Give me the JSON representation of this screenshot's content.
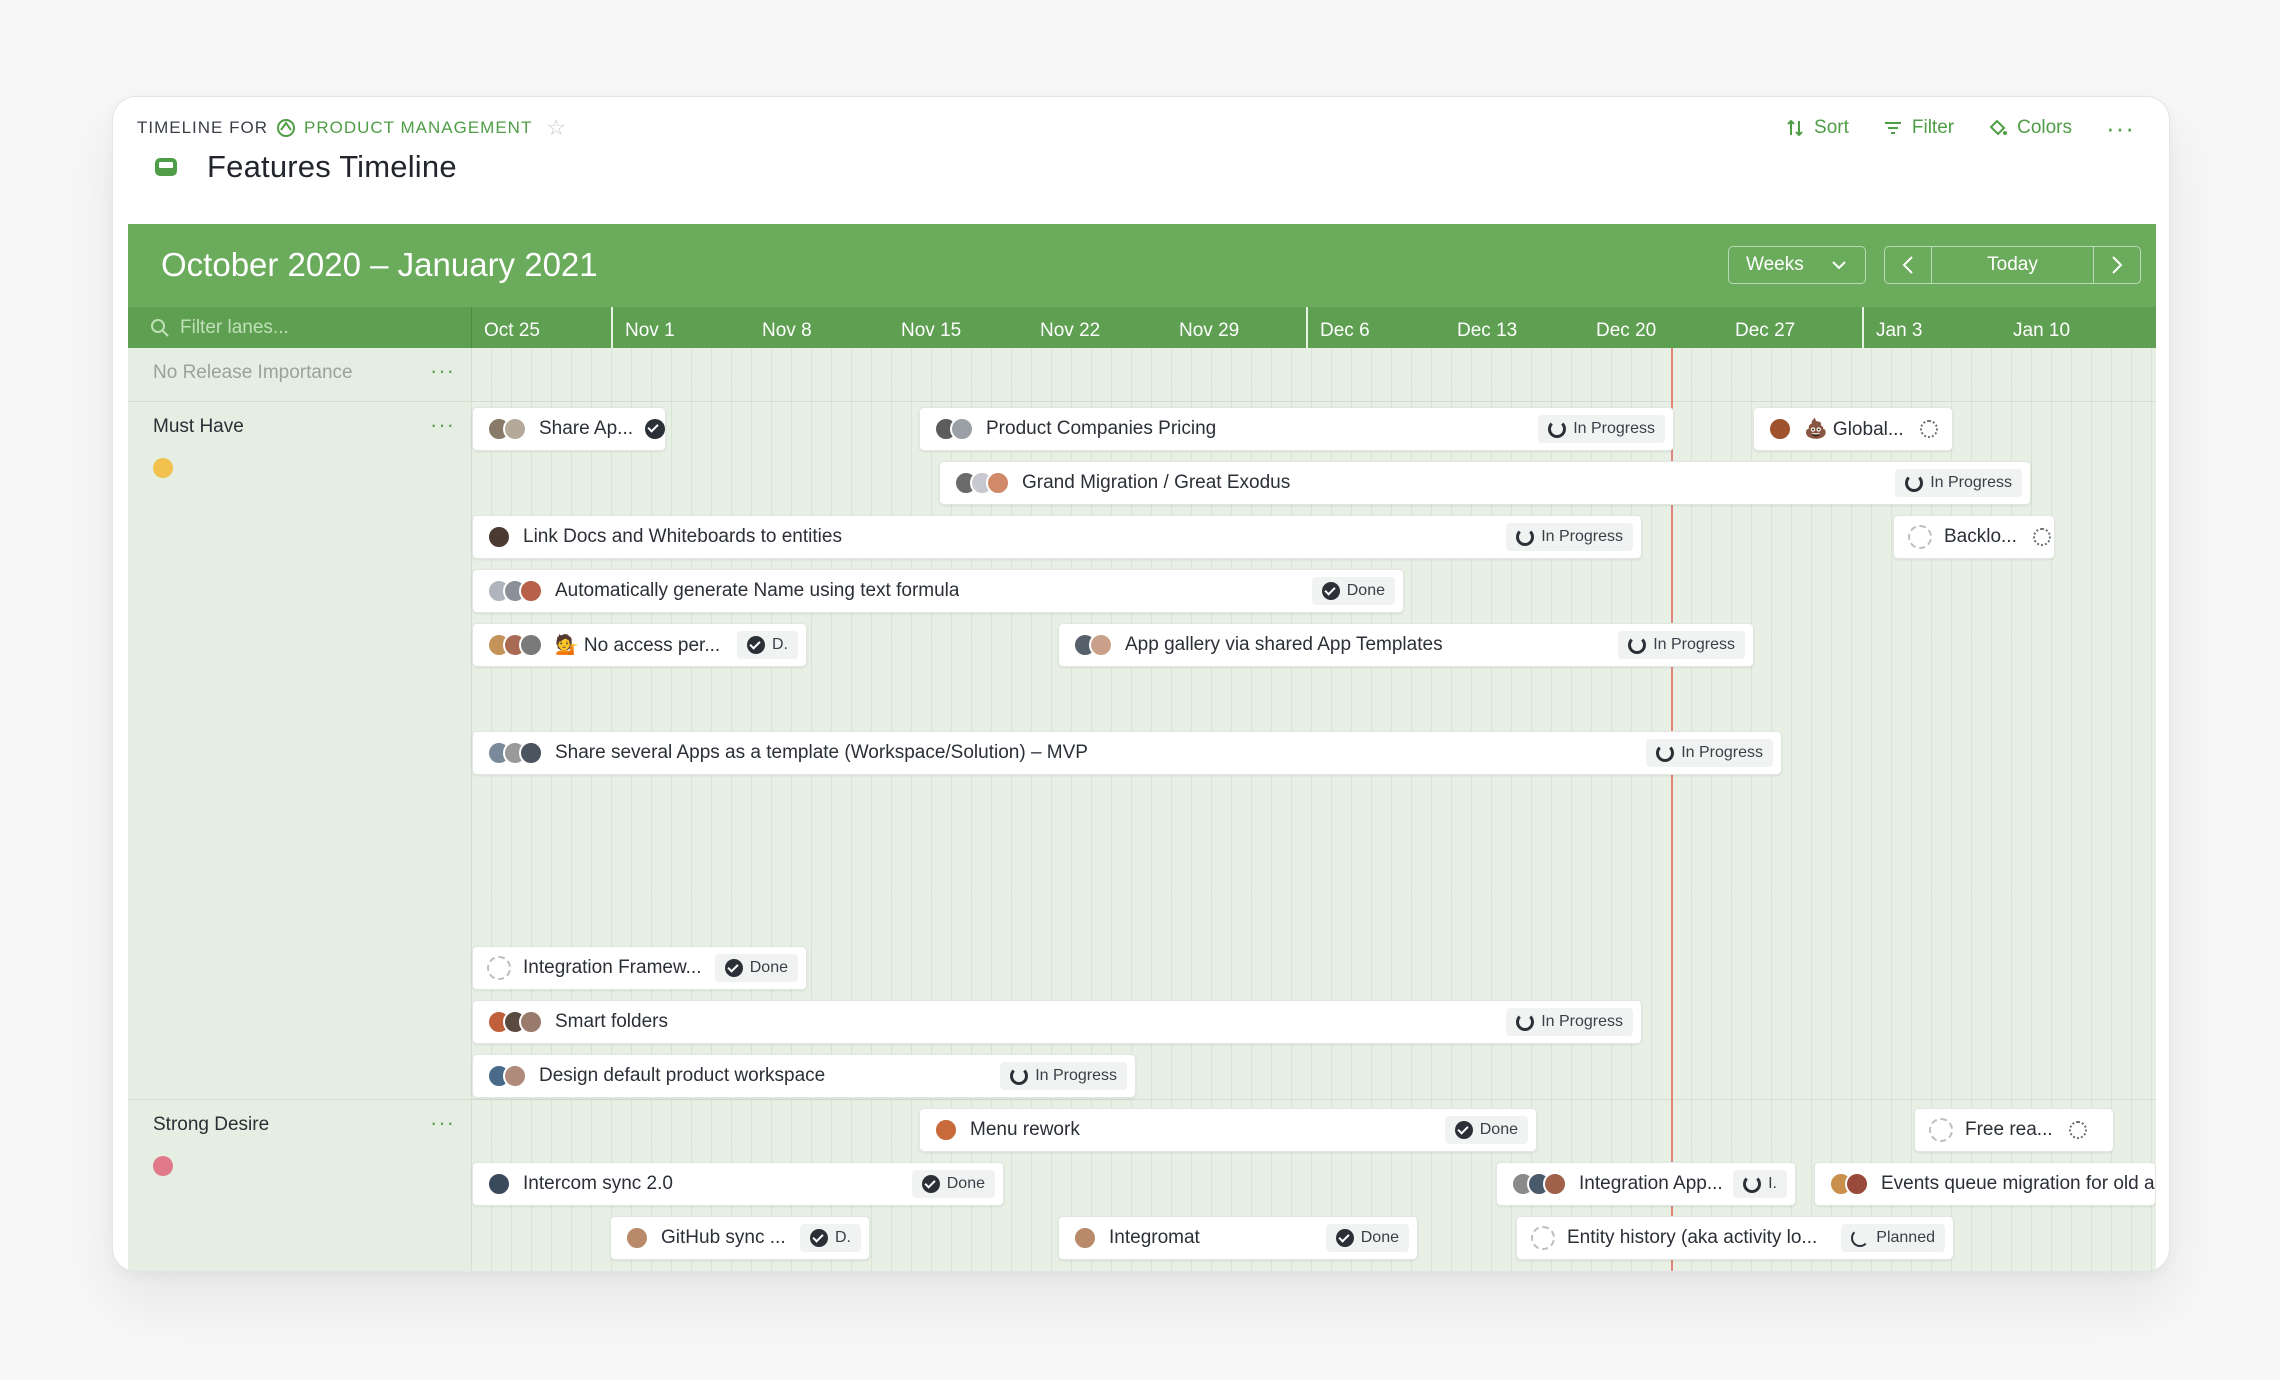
{
  "header": {
    "eyebrow": "TIMELINE FOR",
    "workspace": "PRODUCT MANAGEMENT",
    "title": "Features Timeline",
    "sort": "Sort",
    "filter": "Filter",
    "colors": "Colors"
  },
  "timeline": {
    "range": "October 2020 – January 2021",
    "scale": "Weeks",
    "today": "Today",
    "filter_placeholder": "Filter lanes...",
    "weeks": [
      "Oct 25",
      "Nov 1",
      "Nov 8",
      "Nov 15",
      "Nov 22",
      "Nov 29",
      "Dec 6",
      "Dec 13",
      "Dec 20",
      "Dec 27",
      "Jan 3",
      "Jan 10"
    ]
  },
  "lanes": {
    "none": "No Release Importance",
    "must": "Must Have",
    "strong": "Strong Desire"
  },
  "items": {
    "i1": {
      "label": "Share Ap...",
      "status": ""
    },
    "i2": {
      "label": "Product Companies Pricing",
      "status": "In Progress"
    },
    "i3": {
      "label": "💩 Global...",
      "status": ""
    },
    "i4": {
      "label": "Grand Migration / Great Exodus",
      "status": "In Progress"
    },
    "i5": {
      "label": "Link Docs and Whiteboards to entities",
      "status": "In Progress"
    },
    "i6": {
      "label": "Backlo...",
      "status": ""
    },
    "i7": {
      "label": "Automatically generate Name using text formula",
      "status": "Done"
    },
    "i8": {
      "label": "💁 No access per...",
      "status": "D."
    },
    "i9": {
      "label": "App gallery via shared App Templates",
      "status": "In Progress"
    },
    "i10": {
      "label": "Share several Apps as a template (Workspace/Solution) – MVP",
      "status": "In Progress"
    },
    "i11": {
      "label": "Integration Framew...",
      "status": "Done"
    },
    "i12": {
      "label": "Smart folders",
      "status": "In Progress"
    },
    "i13": {
      "label": "Design default product workspace",
      "status": "In Progress"
    },
    "i14": {
      "label": "Menu rework",
      "status": "Done"
    },
    "i15": {
      "label": "Free rea...",
      "status": ""
    },
    "i16": {
      "label": "Intercom sync 2.0",
      "status": "Done"
    },
    "i17": {
      "label": "Integration App...",
      "status": "I."
    },
    "i18": {
      "label": "Events queue migration for old accounts PI",
      "status": ""
    },
    "i19": {
      "label": "GitHub sync ...",
      "status": "D."
    },
    "i20": {
      "label": "Integromat",
      "status": "Done"
    },
    "i21": {
      "label": "Entity history (aka activity lo...",
      "status": "Planned"
    }
  },
  "colors": {
    "accent": "#4f9d46",
    "header_green": "#6aab5c",
    "today_line": "#e2857a"
  }
}
